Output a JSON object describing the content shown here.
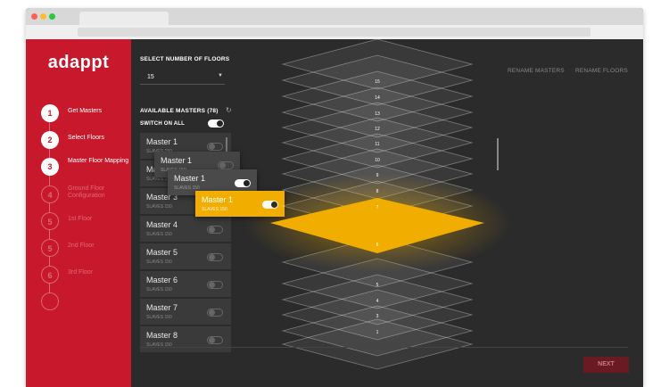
{
  "browser": {
    "dots": [
      "#ff5f57",
      "#ffbd2e",
      "#28c840"
    ]
  },
  "app": {
    "logo": "adappt",
    "steps": [
      {
        "num": "1",
        "label": "Get Masters",
        "state": "done"
      },
      {
        "num": "2",
        "label": "Select Floors",
        "state": "done"
      },
      {
        "num": "3",
        "label": "Master Floor Mapping",
        "state": "current"
      },
      {
        "num": "4",
        "label": "Ground Floor Configuration",
        "state": "todo"
      },
      {
        "num": "5",
        "label": "1st Floor",
        "state": "todo"
      },
      {
        "num": "5",
        "label": "2nd Floor",
        "state": "todo"
      },
      {
        "num": "6",
        "label": "3rd Floor",
        "state": "todo"
      },
      {
        "num": "",
        "label": "",
        "state": "todo"
      }
    ],
    "floor_select": {
      "caption": "SELECT NUMBER OF FLOORS",
      "value": "15"
    },
    "available_masters": {
      "caption": "AVAILABLE MASTERS (78)",
      "switch_all_label": "SWITCH ON ALL",
      "switch_all_on": true
    },
    "masters": [
      {
        "name": "Master 1",
        "sub": "SLAVES 150",
        "on": false
      },
      {
        "name": "Master 2",
        "sub": "SLAVES 150",
        "on": false
      },
      {
        "name": "Master 3",
        "sub": "SLAVES 150",
        "on": false
      },
      {
        "name": "Master 4",
        "sub": "SLAVES 150",
        "on": false
      },
      {
        "name": "Master 5",
        "sub": "SLAVES 150",
        "on": false
      },
      {
        "name": "Master 6",
        "sub": "SLAVES 150",
        "on": false
      },
      {
        "name": "Master 7",
        "sub": "SLAVES 150",
        "on": false
      },
      {
        "name": "Master 8",
        "sub": "SLAVES 150",
        "on": false
      }
    ],
    "dragged_cards": [
      {
        "name": "Master 1",
        "sub": "SLAVES 150"
      },
      {
        "name": "Master 1",
        "sub": "SLAVES 150"
      },
      {
        "name": "Master 1",
        "sub": "SLAVES 150"
      }
    ],
    "top_links": {
      "rename_masters": "RENAME MASTERS",
      "rename_floors": "RENAME FLOORS"
    },
    "floors": {
      "upper_numbers": [
        "15",
        "14",
        "13",
        "12",
        "11",
        "10",
        "9",
        "8",
        "7"
      ],
      "highlighted": "6",
      "lower_numbers": [
        "5",
        "4",
        "3",
        "1"
      ]
    },
    "next_label": "NEXT",
    "colors": {
      "brand_red": "#c8182b",
      "highlight_yellow": "#f2ae00",
      "panel_dark": "#2b2b2b"
    }
  }
}
